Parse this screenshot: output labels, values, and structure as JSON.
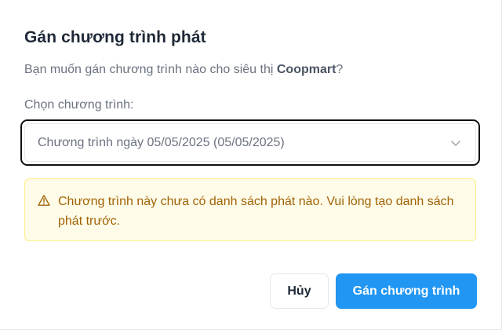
{
  "dialog": {
    "title": "Gán chương trình phát",
    "subtitle_prefix": "Bạn muốn gán chương trình nào cho siêu thị ",
    "store_name": "Coopmart",
    "subtitle_suffix": "?",
    "field_label": "Chọn chương trình:",
    "select": {
      "selected_value": "Chương trình ngày 05/05/2025 (05/05/2025)",
      "icon": "chevron-down-icon"
    },
    "warning": {
      "icon": "warning-triangle-icon",
      "text": "Chương trình này chưa có danh sách phát nào. Vui lòng tạo danh sách phát trước."
    },
    "buttons": {
      "cancel_label": "Hủy",
      "confirm_label": "Gán chương trình"
    }
  },
  "colors": {
    "primary": "#2196f3",
    "warning_bg": "#fefce8",
    "warning_border": "#fef08a",
    "warning_text": "#a16207",
    "focus_ring": "#111111"
  }
}
